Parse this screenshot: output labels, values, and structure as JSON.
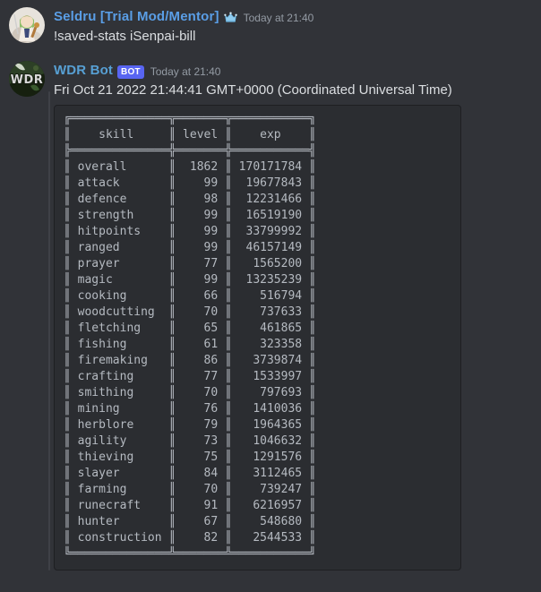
{
  "messages": [
    {
      "id": "user-command",
      "author": "Seldru [Trial Mod/Mentor]",
      "author_color": "#5a9ee6",
      "badge_icon": "crown-icon",
      "timestamp": "Today at 21:40",
      "content": "!saved-stats iSenpai-bill"
    },
    {
      "id": "bot-response",
      "author": "WDR Bot",
      "author_color": "#57a0d4",
      "bot_tag": "BOT",
      "timestamp": "Today at 21:40",
      "content": "Fri Oct 21 2022 21:44:41 GMT+0000 (Coordinated Universal Time)"
    }
  ],
  "stats_table": {
    "columns": [
      "skill",
      "level",
      "exp"
    ],
    "rows": [
      [
        "overall",
        "1862",
        "170171784"
      ],
      [
        "attack",
        "99",
        "19677843"
      ],
      [
        "defence",
        "98",
        "12231466"
      ],
      [
        "strength",
        "99",
        "16519190"
      ],
      [
        "hitpoints",
        "99",
        "33799992"
      ],
      [
        "ranged",
        "99",
        "46157149"
      ],
      [
        "prayer",
        "77",
        "1565200"
      ],
      [
        "magic",
        "99",
        "13235239"
      ],
      [
        "cooking",
        "66",
        "516794"
      ],
      [
        "woodcutting",
        "70",
        "737633"
      ],
      [
        "fletching",
        "65",
        "461865"
      ],
      [
        "fishing",
        "61",
        "323358"
      ],
      [
        "firemaking",
        "86",
        "3739874"
      ],
      [
        "crafting",
        "77",
        "1533997"
      ],
      [
        "smithing",
        "70",
        "797693"
      ],
      [
        "mining",
        "76",
        "1410036"
      ],
      [
        "herblore",
        "79",
        "1964365"
      ],
      [
        "agility",
        "73",
        "1046632"
      ],
      [
        "thieving",
        "75",
        "1291576"
      ],
      [
        "slayer",
        "84",
        "3112465"
      ],
      [
        "farming",
        "70",
        "739247"
      ],
      [
        "runecraft",
        "91",
        "6216957"
      ],
      [
        "hunter",
        "67",
        "548680"
      ],
      [
        "construction",
        "82",
        "2544533"
      ]
    ]
  },
  "colors": {
    "page_background": "#313338",
    "codeblock_background": "#2b2d31",
    "codeblock_border": "#1e1f22",
    "bot_tag_background": "#5865f2",
    "code_text": "#b5bac1",
    "timestamp_text": "#949ba4"
  }
}
